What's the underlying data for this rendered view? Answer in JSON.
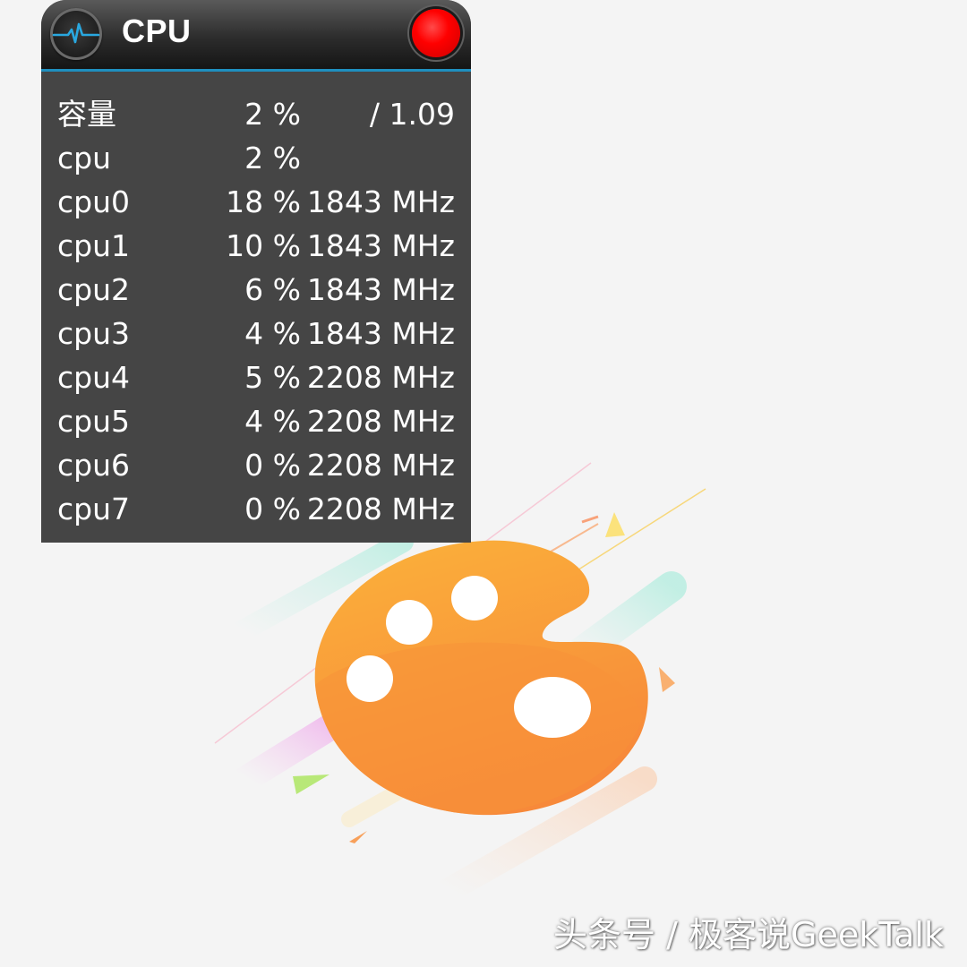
{
  "widget": {
    "title": "CPU",
    "header_icon": "pulse-wave-icon",
    "close_icon": "red-circle-close-button",
    "accent_color": "#1f8fbf",
    "close_color": "#ff0000"
  },
  "rows": [
    {
      "name": "容量",
      "percent": "2 %",
      "freq": "/ 1.09"
    },
    {
      "name": "cpu",
      "percent": "2 %",
      "freq": ""
    },
    {
      "name": "cpu0",
      "percent": "18 %",
      "freq": "1843 MHz"
    },
    {
      "name": "cpu1",
      "percent": "10 %",
      "freq": "1843 MHz"
    },
    {
      "name": "cpu2",
      "percent": "6 %",
      "freq": "1843 MHz"
    },
    {
      "name": "cpu3",
      "percent": "4 %",
      "freq": "1843 MHz"
    },
    {
      "name": "cpu4",
      "percent": "5 %",
      "freq": "2208 MHz"
    },
    {
      "name": "cpu5",
      "percent": "4 %",
      "freq": "2208 MHz"
    },
    {
      "name": "cpu6",
      "percent": "0 %",
      "freq": "2208 MHz"
    },
    {
      "name": "cpu7",
      "percent": "0 %",
      "freq": "2208 MHz"
    }
  ],
  "background": {
    "logo_icon": "paint-palette-icon",
    "palette_color": "#f9a032"
  },
  "watermark": {
    "text": "头条号 / 极客说GeekTalk"
  }
}
